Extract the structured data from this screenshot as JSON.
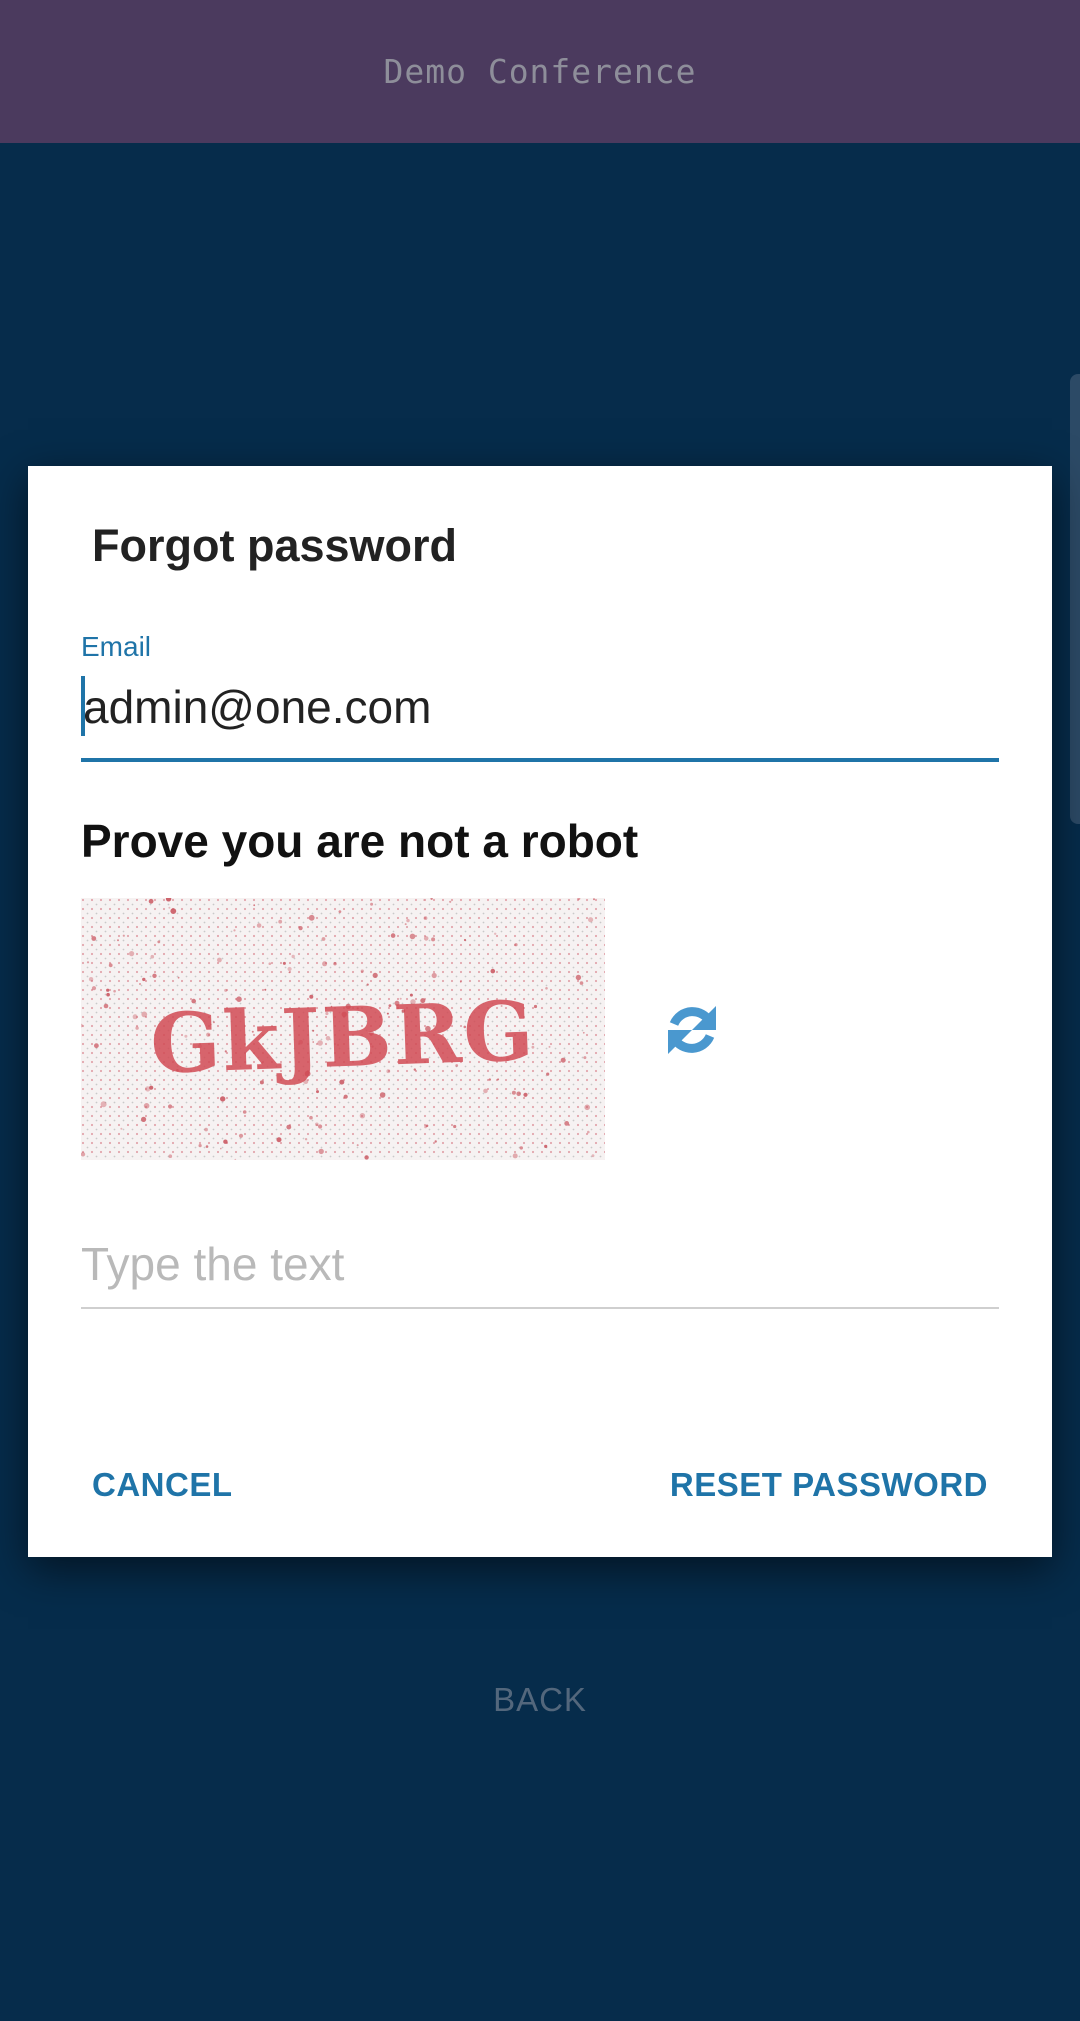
{
  "app": {
    "title": "Demo Conference"
  },
  "background": {
    "back_label": "BACK"
  },
  "dialog": {
    "title": "Forgot password",
    "email": {
      "label": "Email",
      "value": "admin@one.com"
    },
    "captcha": {
      "heading": "Prove you are not a robot",
      "image_text": "GkJBRG",
      "refresh_icon": "refresh-icon",
      "input_placeholder": "Type the text",
      "input_value": ""
    },
    "actions": {
      "cancel_label": "CANCEL",
      "reset_label": "RESET PASSWORD"
    }
  },
  "colors": {
    "header": "#4b3a5e",
    "background": "#062c4b",
    "accent": "#1f74a8",
    "refresh_icon": "#4a98cf",
    "captcha_text": "#d14b55"
  }
}
